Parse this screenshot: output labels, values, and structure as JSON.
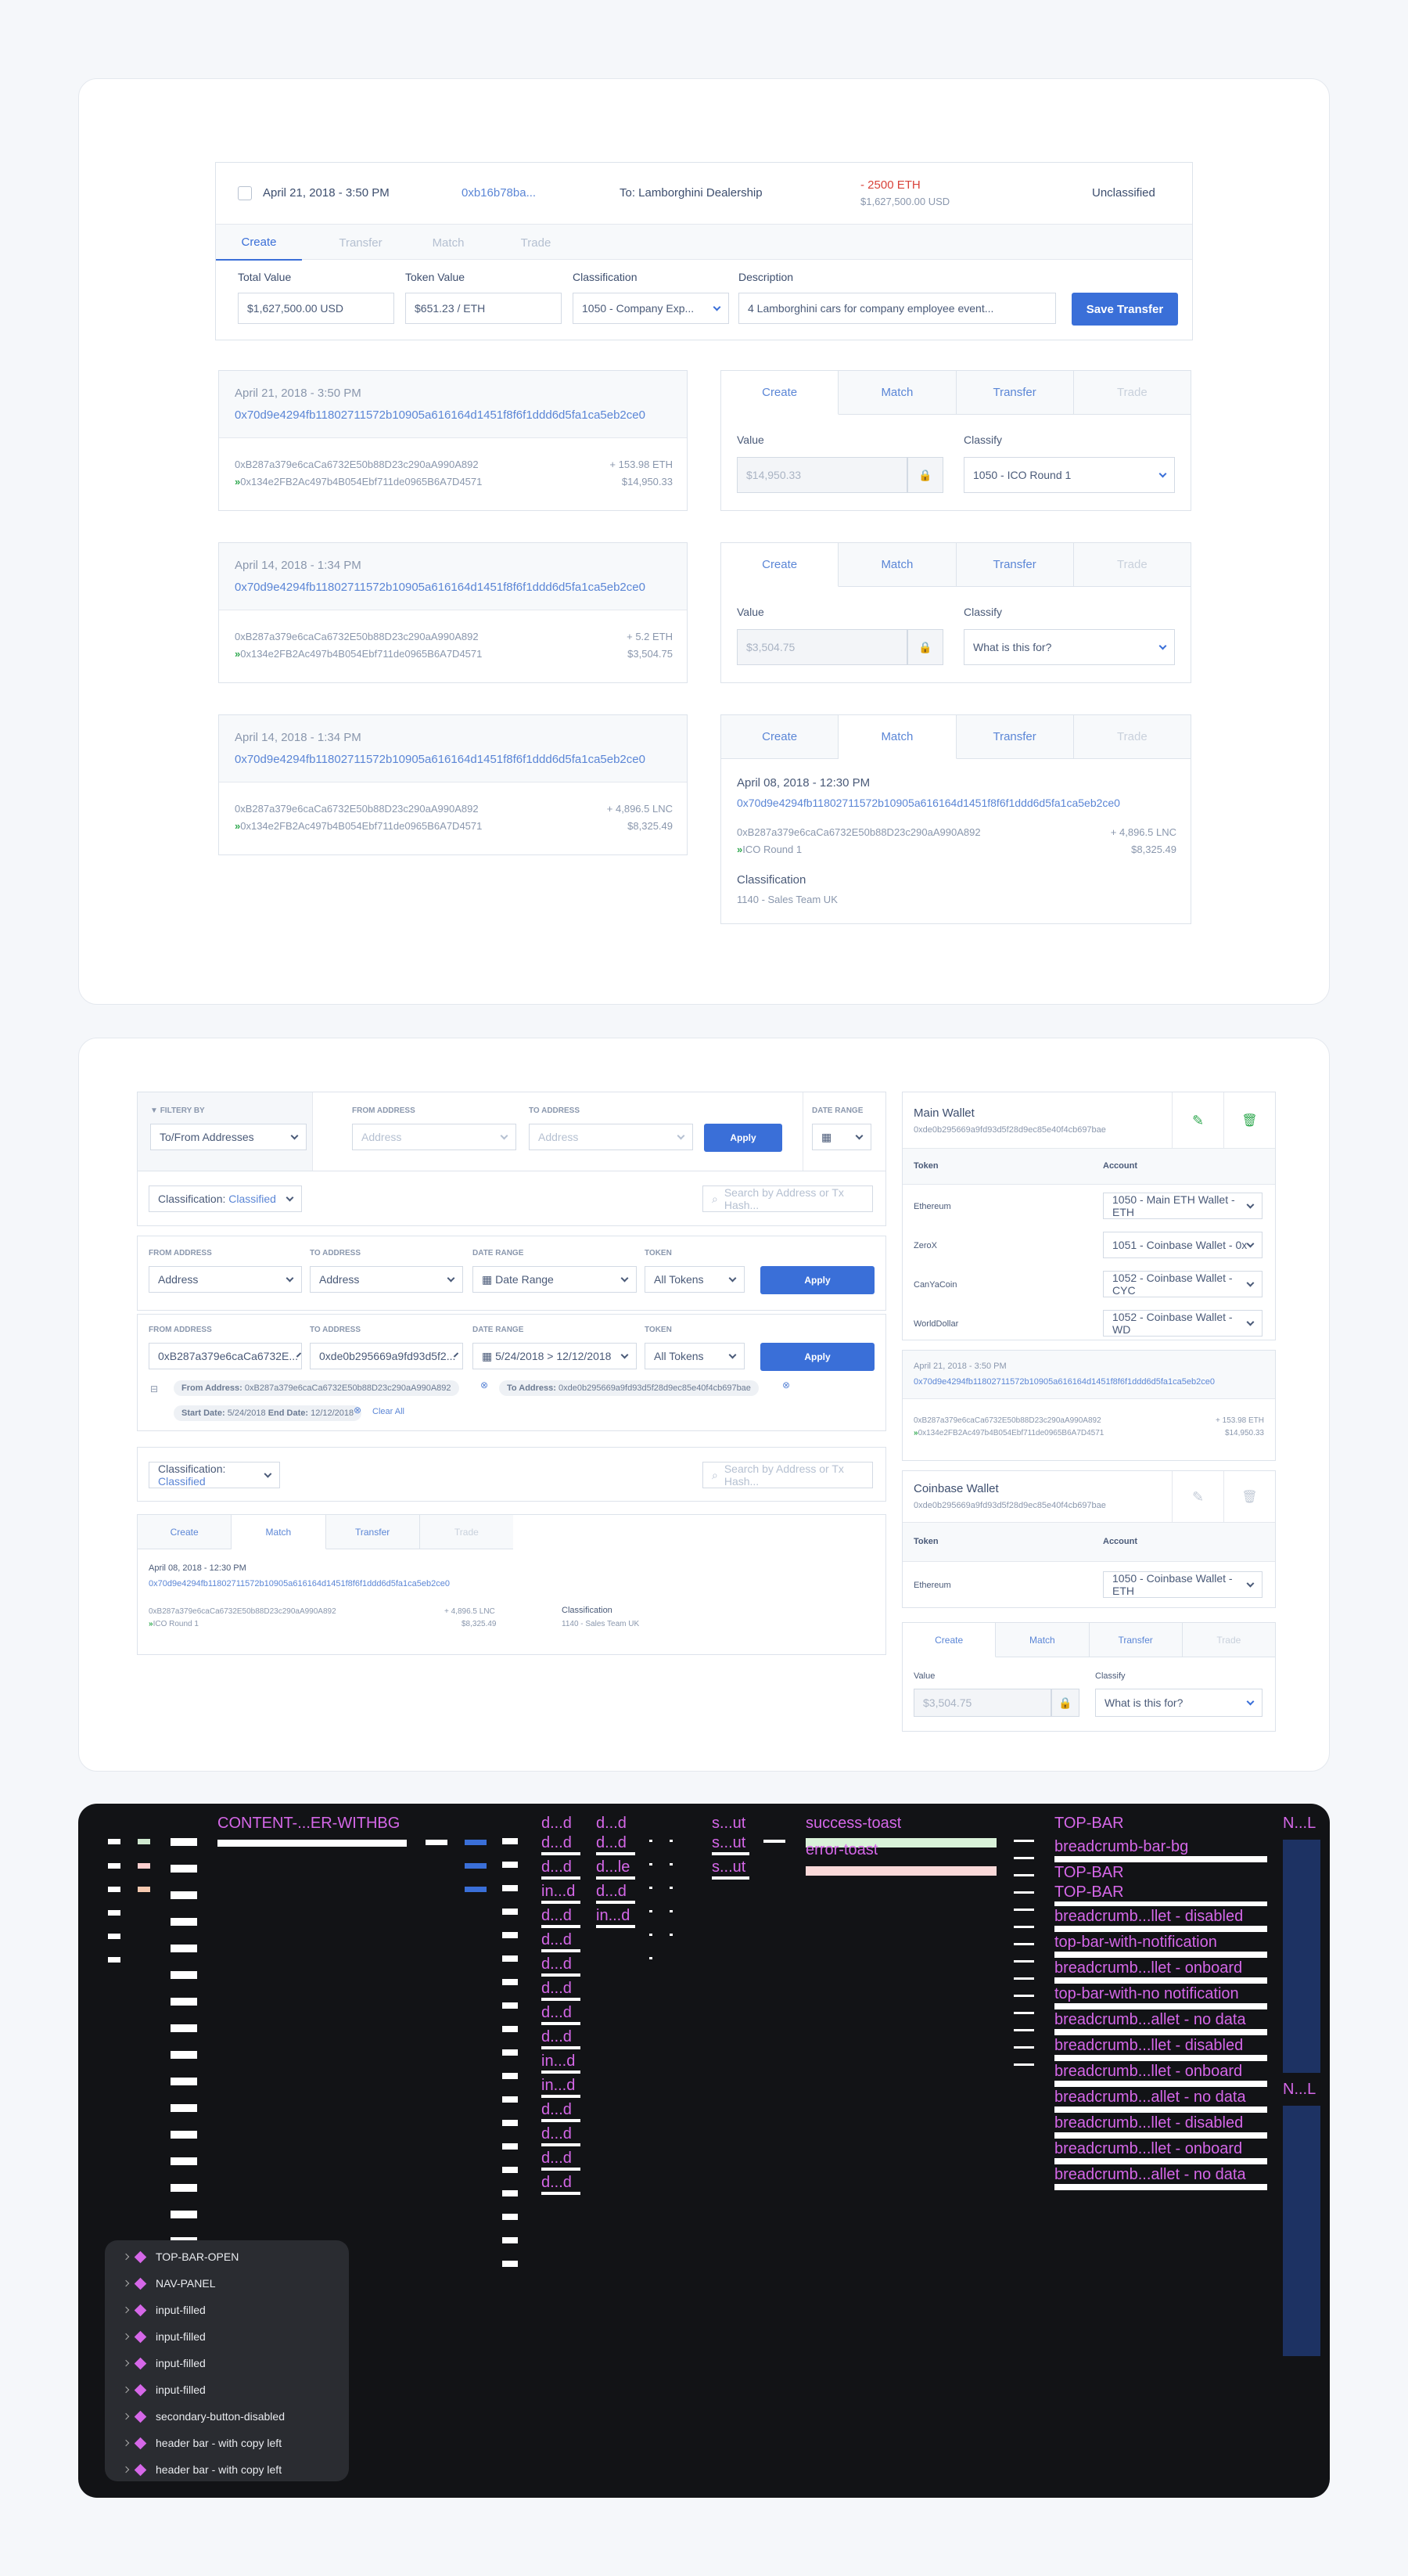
{
  "section1": {
    "top_row": {
      "date": "April 21, 2018 - 3:50 PM",
      "hash": "0xb16b78ba...",
      "to": "To: Lamborghini Dealership",
      "amount": "- 2500 ETH",
      "amount_usd": "$1,627,500.00 USD",
      "status": "Unclassified",
      "tabs": [
        "Create",
        "Transfer",
        "Match",
        "Trade"
      ],
      "labels": {
        "total": "Total Value",
        "token": "Token Value",
        "classification": "Classification",
        "description": "Description"
      },
      "values": {
        "total": "$1,627,500.00 USD",
        "token": "$651.23 / ETH",
        "classification": "1050 - Company Exp...",
        "description": "4 Lamborghini cars for company employee event..."
      },
      "save_label": "Save Transfer"
    },
    "tx": [
      {
        "date": "April 21, 2018 - 3:50 PM",
        "hash": "0x70d9e4294fb11802711572b10905a616164d1451f8f6f1ddd6d5fa1ca5eb2ce0",
        "from": "0xB287a379e6caCa6732E50b88D23c290aA990A892",
        "to": "0x134e2FB2Ac497b4B054Ebf711de0965B6A7D4571",
        "amount": "+ 153.98 ETH",
        "usd": "$14,950.33"
      },
      {
        "date": "April 14, 2018 - 1:34 PM",
        "hash": "0x70d9e4294fb11802711572b10905a616164d1451f8f6f1ddd6d5fa1ca5eb2ce0",
        "from": "0xB287a379e6caCa6732E50b88D23c290aA990A892",
        "to": "0x134e2FB2Ac497b4B054Ebf711de0965B6A7D4571",
        "amount": "+ 5.2 ETH",
        "usd": "$3,504.75"
      },
      {
        "date": "April 14, 2018 - 1:34 PM",
        "hash": "0x70d9e4294fb11802711572b10905a616164d1451f8f6f1ddd6d5fa1ca5eb2ce0",
        "from": "0xB287a379e6caCa6732E50b88D23c290aA990A892",
        "to": "0x134e2FB2Ac497b4B054Ebf711de0965B6A7D4571",
        "amount": "+ 4,896.5 LNC",
        "usd": "$8,325.49"
      }
    ],
    "side_tabs": [
      "Create",
      "Match",
      "Transfer",
      "Trade"
    ],
    "value_label": "Value",
    "classify_label": "Classify",
    "forms": [
      {
        "value": "$14,950.33",
        "classify": "1050 - ICO Round 1"
      },
      {
        "value": "$3,504.75",
        "classify": "What is this for?"
      }
    ],
    "match": {
      "date": "April 08, 2018 - 12:30 PM",
      "hash": "0x70d9e4294fb11802711572b10905a616164d1451f8f6f1ddd6d5fa1ca5eb2ce0",
      "from": "0xB287a379e6caCa6732E50b88D23c290aA990A892",
      "to": "ICO Round 1",
      "amount": "+ 4,896.5 LNC",
      "usd": "$8,325.49",
      "class_label": "Classification",
      "class_value": "1140 - Sales Team UK"
    }
  },
  "section2": {
    "filter_by": "FILTERY BY",
    "filter_value": "To/From Addresses",
    "from_address": "FROM ADDRESS",
    "to_address": "TO ADDRESS",
    "date_range": "DATE RANGE",
    "token": "TOKEN",
    "address_ph": "Address",
    "date_ph": "Date Range",
    "all_tokens": "All Tokens",
    "apply": "Apply",
    "classification_label": "Classification:",
    "classification_value": "Classified",
    "search_ph": "Search by Address or Tx Hash...",
    "from_value": "0xB287a379e6caCa6732E...",
    "to_value": "0xde0b295669a9fd93d5f2...",
    "date_value": "5/24/2018 > 12/12/2018",
    "chip_from_label": "From Address:",
    "chip_from": "0xB287a379e6caCa6732E50b88D23c290aA990A892",
    "chip_to_label": "To Address:",
    "chip_to": "0xde0b295669a9fd93d5f28d9ec85e40f4cb697bae",
    "chip_start_label": "Start Date:",
    "chip_start": "5/24/2018",
    "chip_end_label": "End Date:",
    "chip_end": "12/12/2018",
    "clear_all": "Clear All",
    "tabs": [
      "Create",
      "Match",
      "Transfer",
      "Trade"
    ],
    "match": {
      "date": "April 08, 2018 - 12:30 PM",
      "hash": "0x70d9e4294fb11802711572b10905a616164d1451f8f6f1ddd6d5fa1ca5eb2ce0",
      "from": "0xB287a379e6caCa6732E50b88D23c290aA990A892",
      "to": "ICO Round 1",
      "amount": "+ 4,896.5 LNC",
      "usd": "$8,325.49",
      "class_label": "Classification",
      "class_value": "1140 - Sales Team UK"
    },
    "main_wallet": {
      "title": "Main Wallet",
      "address": "0xde0b295669a9fd93d5f28d9ec85e40f4cb697bae",
      "token_header": "Token",
      "account_header": "Account",
      "rows": [
        {
          "token": "Ethereum",
          "account": "1050 - Main ETH Wallet - ETH"
        },
        {
          "token": "ZeroX",
          "account": "1051 - Coinbase Wallet - 0x"
        },
        {
          "token": "CanYaCoin",
          "account": "1052 - Coinbase Wallet - CYC"
        },
        {
          "token": "WorldDollar",
          "account": "1052 - Coinbase Wallet - WD"
        }
      ]
    },
    "wallet_tx": {
      "date": "April 21, 2018 - 3:50 PM",
      "hash": "0x70d9e4294fb11802711572b10905a616164d1451f8f6f1ddd6d5fa1ca5eb2ce0",
      "from": "0xB287a379e6caCa6732E50b88D23c290aA990A892",
      "to": "0x134e2FB2Ac497b4B054Ebf711de0965B6A7D4571",
      "amount": "+ 153.98 ETH",
      "usd": "$14,950.33"
    },
    "coinbase_wallet": {
      "title": "Coinbase Wallet",
      "address": "0xde0b295669a9fd93d5f28d9ec85e40f4cb697bae",
      "token_header": "Token",
      "account_header": "Account",
      "rows": [
        {
          "token": "Ethereum",
          "account": "1050 - Coinbase Wallet - ETH"
        }
      ]
    },
    "side_form": {
      "value_label": "Value",
      "classify_label": "Classify",
      "value": "$3,504.75",
      "classify": "What is this for?"
    }
  },
  "section3": {
    "frame_labels": {
      "content": "CONTENT-...ER-WITHBG",
      "dd1": "d...d",
      "dd2": "d...d",
      "sut": "s...ut",
      "success": "success-toast",
      "error": "error-toast",
      "topbar": "TOP-BAR",
      "nl1": "N...L",
      "nl2": "N...L"
    },
    "col_dd1": [
      "d...d",
      "d...d",
      "in...d",
      "d...d",
      "d...d",
      "d...d",
      "d...d",
      "d...d",
      "d...d",
      "in...d",
      "in...d",
      "d...d",
      "d...d",
      "d...d",
      "d...d"
    ],
    "col_dd2": [
      "d...d",
      "d...le",
      "d...d",
      "in...d"
    ],
    "col_sut": [
      "s...ut",
      "s...ut"
    ],
    "col_top": [
      "breadcrumb-bar-bg",
      "TOP-BAR",
      "TOP-BAR",
      "breadcrumb...llet - disabled",
      "top-bar-with-notification",
      "breadcrumb...llet - onboard",
      "top-bar-with-no notification",
      "breadcrumb...allet - no data",
      "breadcrumb...llet - disabled",
      "breadcrumb...llet - onboard",
      "breadcrumb...allet - no data",
      "breadcrumb...llet - disabled",
      "breadcrumb...llet - onboard",
      "breadcrumb...allet - no data"
    ],
    "layers": [
      "TOP-BAR-OPEN",
      "NAV-PANEL",
      "input-filled",
      "input-filled",
      "input-filled",
      "input-filled",
      "secondary-button-disabled",
      "header bar - with copy left",
      "header bar - with copy left"
    ]
  }
}
